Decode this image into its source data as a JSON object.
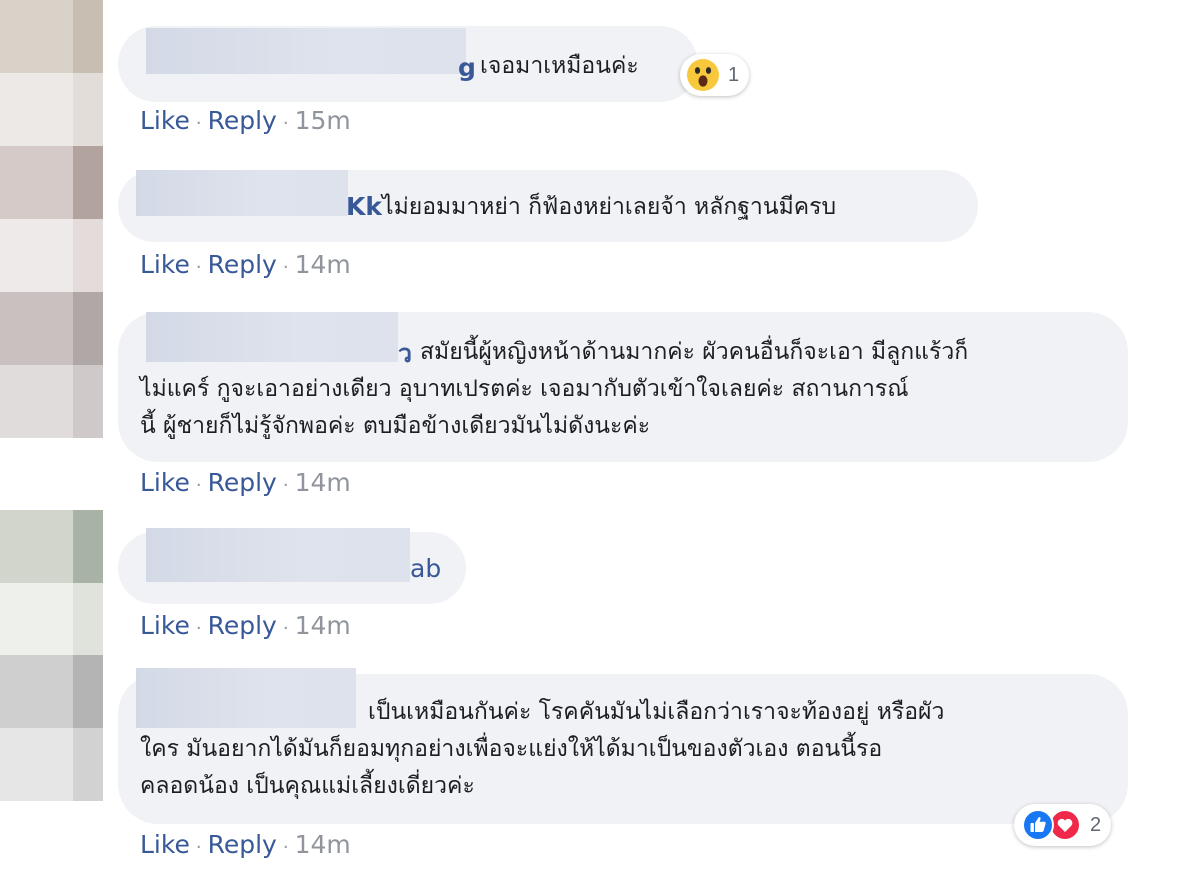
{
  "comments": [
    {
      "name_tail": "g",
      "text_lines": [
        "เจอมาเหมือนค่ะ"
      ],
      "reaction": {
        "icon": "wow-reaction-icon",
        "count": "1"
      },
      "actions": {
        "like": "Like",
        "sep": "·",
        "reply": "Reply",
        "time": "15m"
      }
    },
    {
      "name_tail": "Kk",
      "text_lines": [
        "ไม่ยอมมาหย่า ก็ฟ้องหย่าเลยจ้า หลักฐานมีครบ"
      ],
      "actions": {
        "like": "Like",
        "sep": "·",
        "reply": "Reply",
        "time": "14m"
      }
    },
    {
      "name_tail": "ว",
      "text_lines": [
        "สมัยนี้ผู้หญิงหน้าด้านมากค่ะ ผัวคนอื่นก็จะเอา มีลูกแร้วก็",
        "ไม่แคร์ กูจะเอาอย่างเดียว อุบาทเปรตค่ะ เจอมากับตัวเข้าใจเลยค่ะ สถานการณ์",
        "นี้ ผู้ชายก็ไม่รู้จักพอค่ะ ตบมือข้างเดียวมันไม่ดังนะค่ะ"
      ],
      "actions": {
        "like": "Like",
        "sep": "·",
        "reply": "Reply",
        "time": "14m"
      }
    },
    {
      "name_tail": "ab",
      "text_lines": [],
      "actions": {
        "like": "Like",
        "sep": "·",
        "reply": "Reply",
        "time": "14m"
      }
    },
    {
      "name_tail": "",
      "text_lines": [
        "เป็นเหมือนกันค่ะ โรคคันมันไม่เลือกว่าเราจะท้องอยู่ หรือผัว",
        "ใคร มันอยากได้มันก็ยอมทุกอย่างเพื่อจะแย่งให้ได้มาเป็นของตัวเอง ตอนนี้รอ",
        "คลอดน้อง เป็นคุณแม่เลี้ยงเดี่ยวค่ะ"
      ],
      "reaction": {
        "icon": "like-love-reaction-icon",
        "count": "2"
      },
      "actions": {
        "like": "Like",
        "sep": "·",
        "reply": "Reply",
        "time": "14m"
      }
    }
  ]
}
